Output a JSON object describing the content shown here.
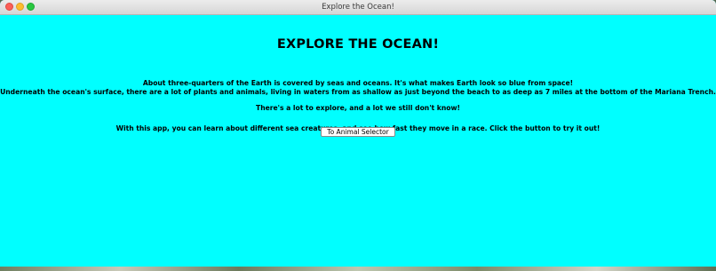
{
  "window": {
    "title": "Explore the Ocean!",
    "background_color": "#00ffff"
  },
  "content": {
    "heading": "EXPLORE THE OCEAN!",
    "paragraph_1_line_1": "About three-quarters of the Earth is covered by seas and oceans. It's what makes Earth look so blue from space!",
    "paragraph_1_line_2": "Underneath the ocean's surface, there are a lot of plants and animals, living in waters from as shallow as just beyond the beach to as deep as 7 miles at the bottom of the Mariana Trench.",
    "paragraph_2": "There's a lot to explore, and a lot we still don't know!",
    "paragraph_3": "With this app, you can learn about different sea creatures, and see how fast they move in a race. Click the button to try it out!",
    "button_label": "To Animal Selector"
  }
}
